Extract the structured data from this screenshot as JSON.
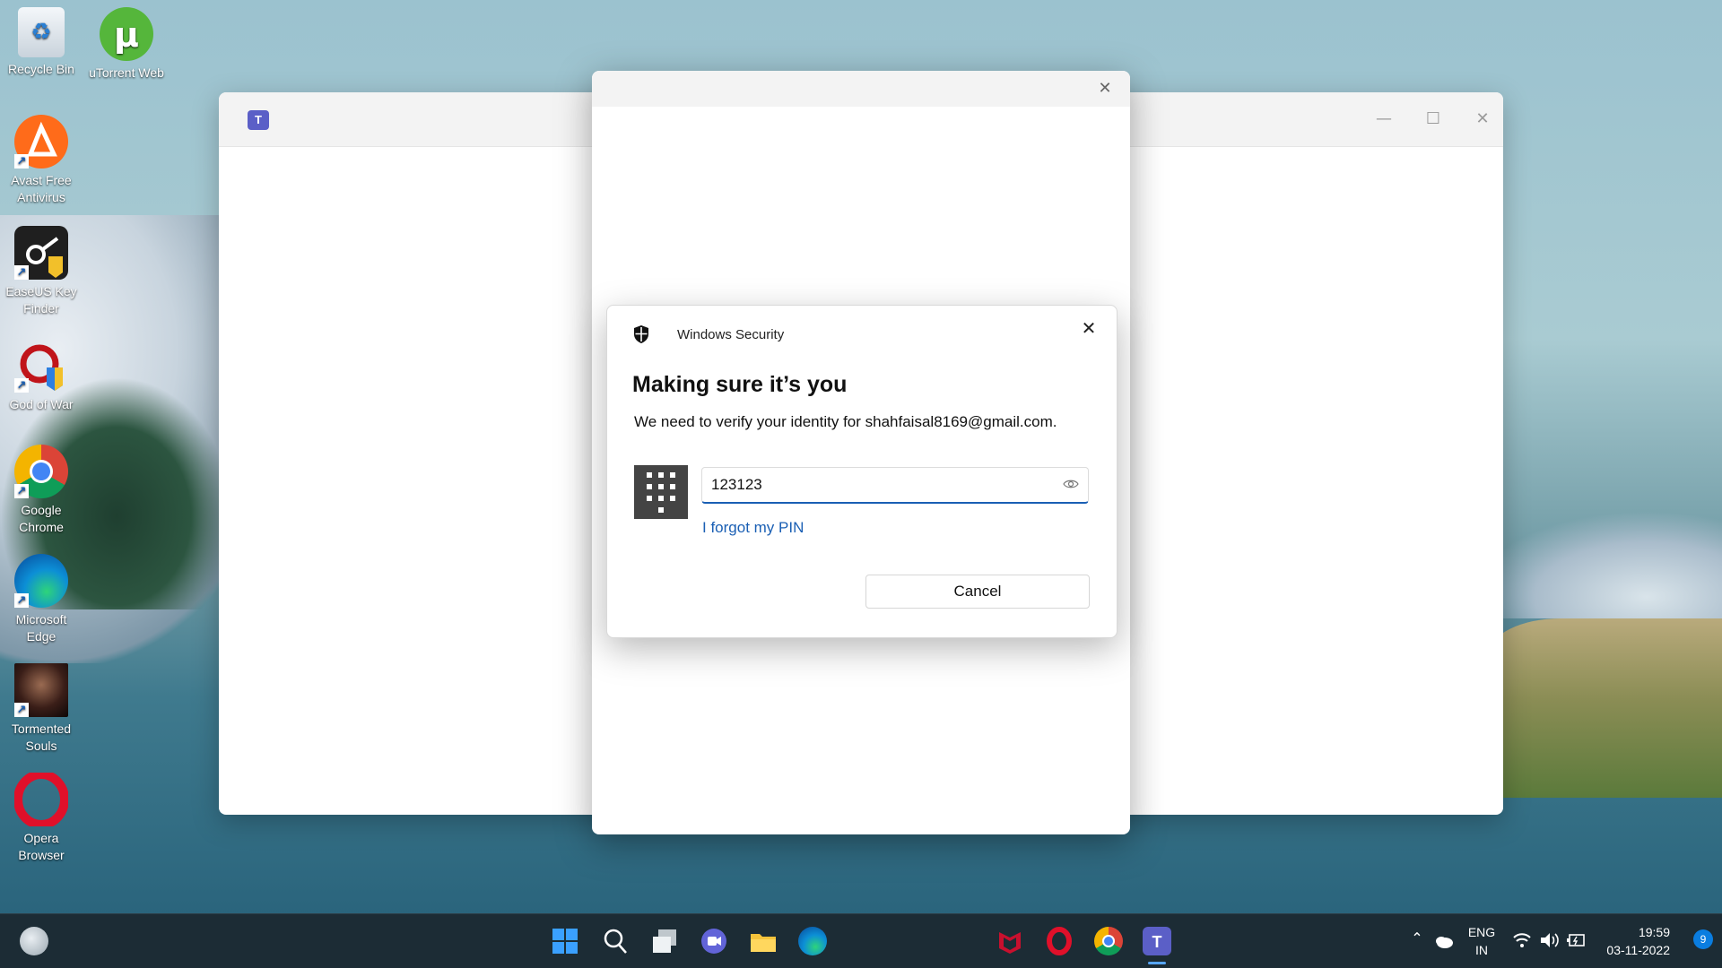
{
  "desktop": {
    "icons": [
      {
        "label": "Recycle Bin"
      },
      {
        "label": "uTorrent Web"
      },
      {
        "label": "Avast Free Antivirus"
      },
      {
        "label": "EaseUS Key Finder"
      },
      {
        "label": "God of War"
      },
      {
        "label": "Google Chrome"
      },
      {
        "label": "Microsoft Edge"
      },
      {
        "label": "Tormented Souls"
      },
      {
        "label": "Opera Browser"
      }
    ]
  },
  "teams_window": {
    "logo_text": "T"
  },
  "security_dialog": {
    "app_name": "Windows Security",
    "title": "Making sure it’s you",
    "message": "We need to verify your identity for shahfaisal8169@gmail.com.",
    "pin_value": "123123",
    "forgot_link": "I forgot my PIN",
    "cancel_label": "Cancel"
  },
  "taskbar": {
    "language_line1": "ENG",
    "language_line2": "IN",
    "time": "19:59",
    "date": "03-11-2022",
    "notification_count": "9"
  },
  "colors": {
    "accent": "#1a5fb4",
    "teams_brand": "#5b5fc7",
    "taskbar_bg": "#1c2c35"
  }
}
